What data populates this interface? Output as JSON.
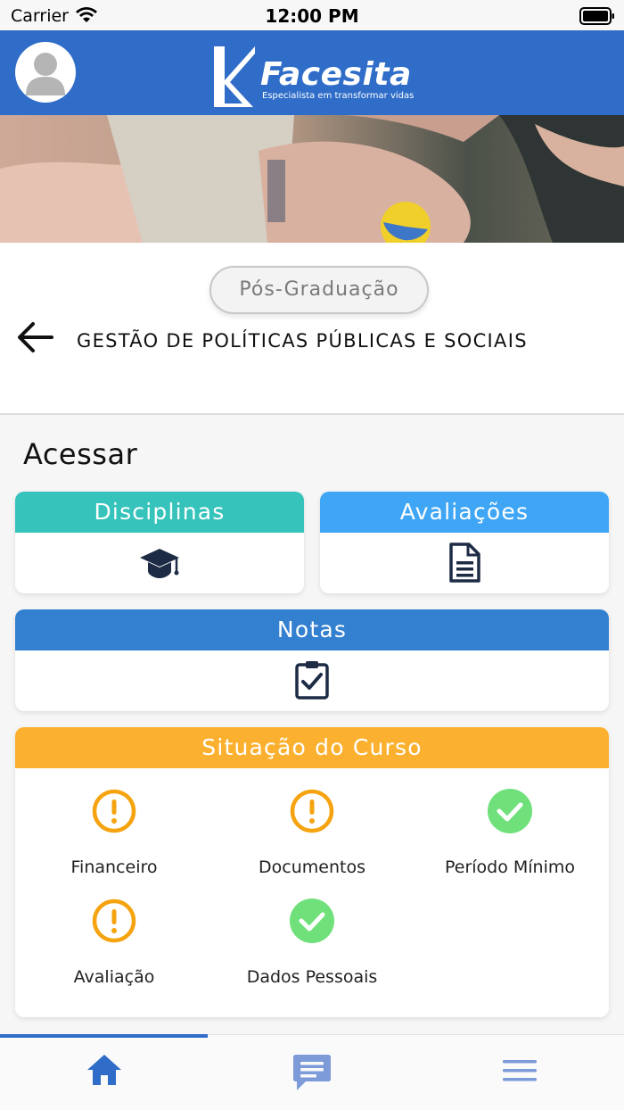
{
  "statusbar": {
    "carrier": "Carrier",
    "time": "12:00 PM"
  },
  "header": {
    "brand": "Facesita",
    "tagline": "Especialista em transformar vidas",
    "accent_color": "#2f6dc8"
  },
  "course": {
    "level": "Pós-Graduação",
    "title": "GESTÃO DE POLÍTICAS PÚBLICAS E SOCIAIS"
  },
  "access": {
    "title": "Acessar",
    "cards": [
      {
        "label": "Disciplinas",
        "icon": "graduation-cap-icon",
        "color": "#36c3bb"
      },
      {
        "label": "Avaliações",
        "icon": "document-icon",
        "color": "#3fa6f5"
      },
      {
        "label": "Notas",
        "icon": "clipboard-check-icon",
        "color": "#3480d0"
      }
    ]
  },
  "situation": {
    "title": "Situação do Curso",
    "color": "#fbb12f",
    "items": [
      {
        "label": "Financeiro",
        "status": "pending",
        "icon": "warning-circle-icon"
      },
      {
        "label": "Documentos",
        "status": "pending",
        "icon": "warning-circle-icon"
      },
      {
        "label": "Período Mínimo",
        "status": "ok",
        "icon": "check-circle-icon"
      },
      {
        "label": "Avaliação",
        "status": "pending",
        "icon": "warning-circle-icon"
      },
      {
        "label": "Dados Pessoais",
        "status": "ok",
        "icon": "check-circle-icon"
      }
    ]
  },
  "tabbar": {
    "tabs": [
      {
        "icon": "home-icon",
        "active": true
      },
      {
        "icon": "chat-icon",
        "active": false
      },
      {
        "icon": "menu-icon",
        "active": false
      }
    ]
  }
}
